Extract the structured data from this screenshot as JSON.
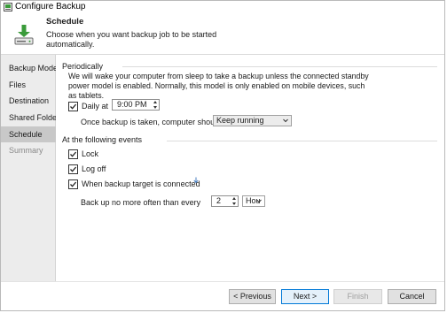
{
  "window": {
    "title": "Configure Backup"
  },
  "header": {
    "title": "Schedule",
    "description": "Choose when you want backup job to be started automatically."
  },
  "sidebar": {
    "items": [
      {
        "label": "Backup Mode"
      },
      {
        "label": "Files"
      },
      {
        "label": "Destination"
      },
      {
        "label": "Shared Folder"
      },
      {
        "label": "Schedule"
      },
      {
        "label": "Summary"
      }
    ]
  },
  "periodically": {
    "heading": "Periodically",
    "info": "We will wake your computer from sleep to take a backup unless the connected standby power model is enabled. Normally, this model is only enabled on mobile devices, such as tablets.",
    "daily_label": "Daily at",
    "daily_checked": true,
    "time_value": "9:00 PM",
    "after_label": "Once backup is taken, computer should",
    "after_value": "Keep running"
  },
  "events": {
    "heading": "At the following events",
    "lock_label": "Lock",
    "lock_checked": true,
    "logoff_label": "Log off",
    "logoff_checked": true,
    "target_label": "When backup target is connected",
    "target_checked": true,
    "frequency_label": "Back up no more often than every",
    "frequency_value": "2",
    "frequency_unit": "Hou"
  },
  "footer": {
    "previous": "< Previous",
    "next": "Next >",
    "finish": "Finish",
    "cancel": "Cancel"
  },
  "colors": {
    "accent": "#0078d7",
    "download_green": "#3a9b3a"
  }
}
